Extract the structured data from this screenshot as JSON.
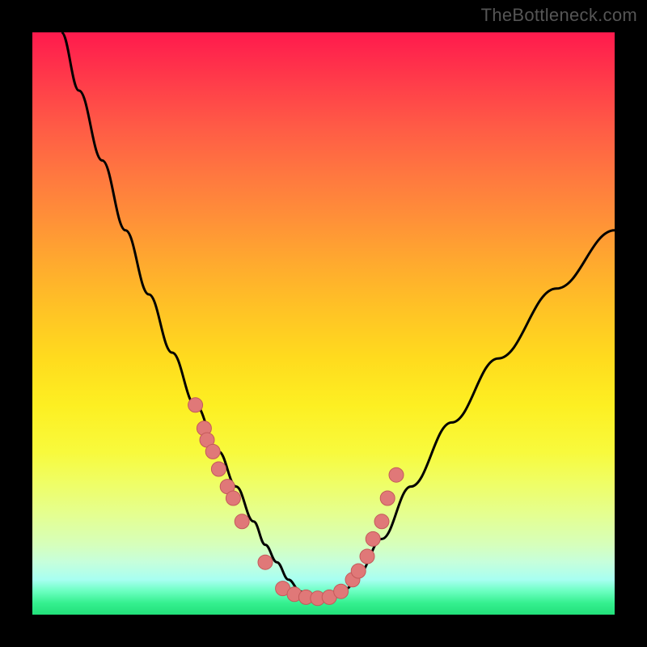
{
  "watermark": "TheBottleneck.com",
  "colors": {
    "page_bg": "#000000",
    "curve": "#000000",
    "dot_fill": "#e07878",
    "dot_stroke": "#c45a5a"
  },
  "chart_data": {
    "type": "line",
    "title": "",
    "xlabel": "",
    "ylabel": "",
    "xlim": [
      0,
      100
    ],
    "ylim": [
      0,
      100
    ],
    "grid": false,
    "legend": false,
    "series": [
      {
        "name": "curve",
        "x": [
          5,
          8,
          12,
          16,
          20,
          24,
          28,
          32,
          35,
          38,
          40,
          42,
          44,
          46,
          48,
          50,
          52,
          54,
          56,
          60,
          65,
          72,
          80,
          90,
          100
        ],
        "y": [
          100,
          90,
          78,
          66,
          55,
          45,
          36,
          28,
          22,
          16,
          12,
          9,
          6,
          4,
          3,
          2.5,
          3,
          4.5,
          7,
          13,
          22,
          33,
          44,
          56,
          66
        ]
      }
    ],
    "scatter": [
      {
        "name": "dots",
        "x": [
          28,
          29.5,
          30,
          31,
          32,
          33.5,
          34.5,
          36,
          40,
          43,
          45,
          47,
          49,
          51,
          53,
          55,
          56,
          57.5,
          58.5,
          60,
          61,
          62.5
        ],
        "y": [
          36,
          32,
          30,
          28,
          25,
          22,
          20,
          16,
          9,
          4.5,
          3.5,
          3,
          2.8,
          3,
          4,
          6,
          7.5,
          10,
          13,
          16,
          20,
          24
        ]
      }
    ]
  }
}
